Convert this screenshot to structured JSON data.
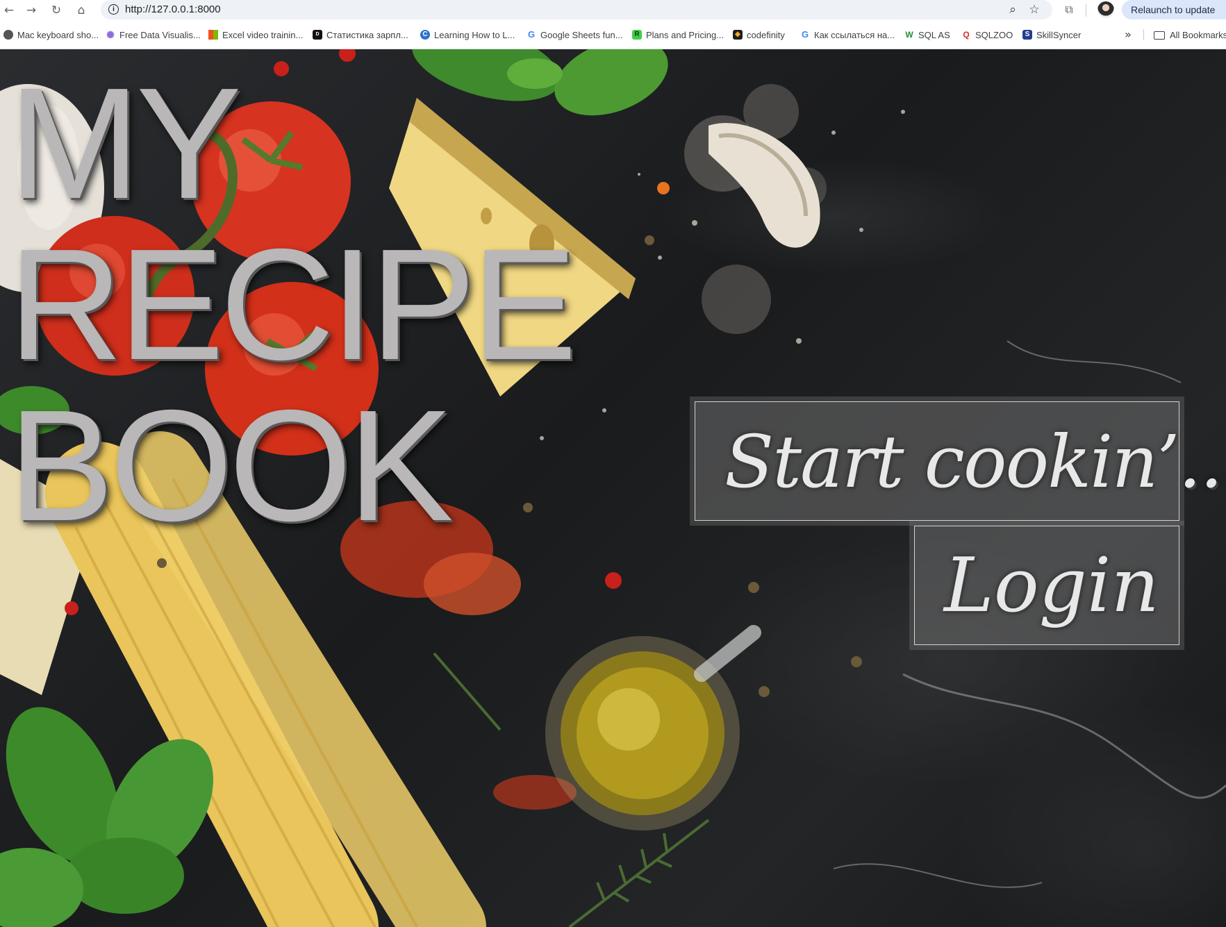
{
  "browser": {
    "nav": {
      "back_icon": "←",
      "forward_icon": "→",
      "reload_icon": "↻",
      "home_icon": "⌂"
    },
    "url": "http://127.0.0.1:8000",
    "icons": {
      "info": "i",
      "zoom": "⌕",
      "star": "☆",
      "extensions": "⧉"
    },
    "relaunch_label": "Relaunch to update",
    "bookmarks": [
      {
        "label": "Mac keyboard sho...",
        "icon": "apple-icon",
        "color": "#555555",
        "glyph": ""
      },
      {
        "label": "Free Data Visualis...",
        "icon": "dots-icon",
        "color": "#8e6bd8",
        "glyph": "✺"
      },
      {
        "label": "Excel video trainin...",
        "icon": "microsoft-icon",
        "color": "#f25022",
        "glyph": ""
      },
      {
        "label": "Статистика зарпл...",
        "icon": "dou-icon",
        "color": "#111111",
        "glyph": "D"
      },
      {
        "label": "Learning How to L...",
        "icon": "coursera-icon",
        "color": "#2a73cc",
        "glyph": "C"
      },
      {
        "label": "Google Sheets fun...",
        "icon": "google-icon",
        "color": "#ffffff",
        "glyph": "G"
      },
      {
        "label": "Plans and Pricing...",
        "icon": "plans-icon",
        "color": "#3ecf4a",
        "glyph": "R"
      },
      {
        "label": "codefinity",
        "icon": "codefinity-icon",
        "color": "#1d1d1d",
        "glyph": "◆"
      },
      {
        "label": "Как ссылаться на...",
        "icon": "google-icon",
        "color": "#ffffff",
        "glyph": "G"
      },
      {
        "label": "SQL AS",
        "icon": "w-icon",
        "color": "#ffffff",
        "glyph": "W"
      },
      {
        "label": "SQLZOO",
        "icon": "sqlzoo-icon",
        "color": "#ffffff",
        "glyph": "Q"
      },
      {
        "label": "SkillSyncer",
        "icon": "skillsyncer-icon",
        "color": "#213d8f",
        "glyph": "S"
      }
    ],
    "more_icon": "»",
    "all_bookmarks_label": "All Bookmarks"
  },
  "page": {
    "title_lines": [
      "MY",
      "RECIPE",
      "BOOK"
    ],
    "start_button_label": "Start cookin’...",
    "login_button_label": "Login"
  },
  "colors": {
    "title_text": "#b9b7b7",
    "button_bg": "rgba(110,110,110,0.55)",
    "relaunch_bg": "#dbe6fb"
  }
}
